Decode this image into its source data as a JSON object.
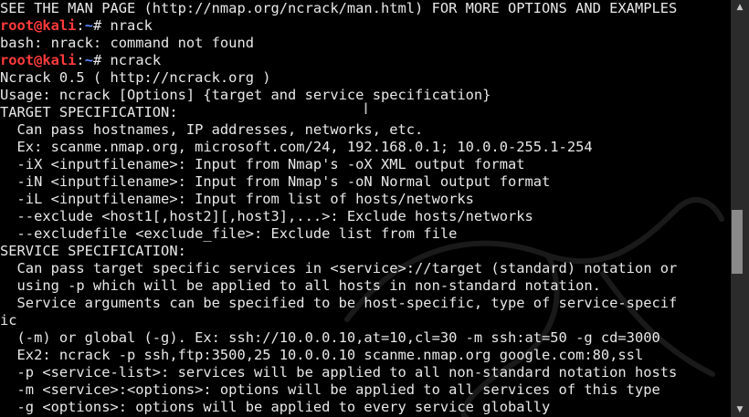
{
  "colors": {
    "background": "#000000",
    "text": "#e8e8e8",
    "prompt_user": "#ff3b3b",
    "prompt_path": "#5b8cff",
    "scrollbar_track": "#2b2b2b",
    "scrollbar_thumb": "#8a8a8a"
  },
  "icons": {
    "scroll_up": "triangle-up",
    "scroll_down": "triangle-down",
    "mouse_cursor": "i-beam"
  },
  "terminal": {
    "top_line": "SEE THE MAN PAGE (http://nmap.org/ncrack/man.html) FOR MORE OPTIONS AND EXAMPLES",
    "prompts": [
      {
        "user": "root@kali",
        "colon": ":",
        "path": "~",
        "symbol": "# ",
        "command": "nrack"
      },
      {
        "user": "root@kali",
        "colon": ":",
        "path": "~",
        "symbol": "# ",
        "command": "ncrack"
      }
    ],
    "error_line": "bash: nrack: command not found",
    "output": [
      "Ncrack 0.5 ( http://ncrack.org )",
      "Usage: ncrack [Options] {target and service specification}",
      "TARGET SPECIFICATION:",
      "  Can pass hostnames, IP addresses, networks, etc.",
      "  Ex: scanme.nmap.org, microsoft.com/24, 192.168.0.1; 10.0.0-255.1-254",
      "  -iX <inputfilename>: Input from Nmap's -oX XML output format",
      "  -iN <inputfilename>: Input from Nmap's -oN Normal output format",
      "  -iL <inputfilename>: Input from list of hosts/networks",
      "  --exclude <host1[,host2][,host3],...>: Exclude hosts/networks",
      "  --excludefile <exclude_file>: Exclude list from file",
      "SERVICE SPECIFICATION:",
      "  Can pass target specific services in <service>://target (standard) notation or",
      "  using -p which will be applied to all hosts in non-standard notation.",
      "  Service arguments can be specified to be host-specific, type of service-specif",
      "ic",
      "  (-m) or global (-g). Ex: ssh://10.0.0.10,at=10,cl=30 -m ssh:at=50 -g cd=3000",
      "  Ex2: ncrack -p ssh,ftp:3500,25 10.0.0.10 scanme.nmap.org google.com:80,ssl",
      "  -p <service-list>: services will be applied to all non-standard notation hosts",
      "  -m <service>:<options>: options will be applied to all services of this type",
      "  -g <options>: options will be applied to every service globally"
    ]
  },
  "scrollbar": {
    "up_glyph": "▲",
    "down_glyph": "▼"
  },
  "cursor": {
    "glyph": "I"
  }
}
